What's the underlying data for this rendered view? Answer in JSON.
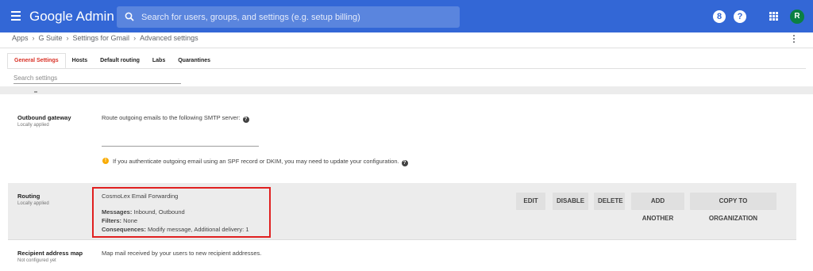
{
  "header": {
    "app_title": "Google Admin",
    "search_placeholder": "Search for users, groups, and settings (e.g. setup billing)",
    "support_badge": "8",
    "help_label": "?",
    "avatar_initial": "R",
    "brand_color": "#3367d6"
  },
  "breadcrumb": [
    "Apps",
    "G Suite",
    "Settings for Gmail",
    "Advanced settings"
  ],
  "tabs": [
    {
      "label": "General Settings",
      "active": true
    },
    {
      "label": "Hosts",
      "active": false
    },
    {
      "label": "Default routing",
      "active": false
    },
    {
      "label": "Labs",
      "active": false
    },
    {
      "label": "Quarantines",
      "active": false
    }
  ],
  "search_settings_placeholder": "Search settings",
  "outbound_gateway": {
    "title": "Outbound gateway",
    "status": "Locally applied",
    "description": "Route outgoing emails to the following SMTP server:",
    "smtp_value": "",
    "warning": "If you authenticate outgoing email using an SPF record or DKIM, you may need to update your configuration."
  },
  "routing": {
    "title": "Routing",
    "status": "Locally applied",
    "rule_name": "CosmoLex Email Forwarding",
    "messages_label": "Messages:",
    "messages_value": "Inbound, Outbound",
    "filters_label": "Filters:",
    "filters_value": "None",
    "consequences_label": "Consequences:",
    "consequences_value": "Modify message, Additional delivery: 1",
    "buttons": {
      "edit": "EDIT",
      "disable": "DISABLE",
      "delete": "DELETE",
      "add_another": "ADD ANOTHER",
      "copy": "COPY TO ORGANIZATION"
    }
  },
  "recipient_map": {
    "title": "Recipient address map",
    "status": "Not configured yet",
    "description": "Map mail received by your users to new recipient addresses."
  },
  "icons": [
    "menu-icon",
    "search-icon",
    "support-icon",
    "help-icon",
    "apps-grid-icon",
    "more-vert-icon",
    "warning-icon"
  ]
}
